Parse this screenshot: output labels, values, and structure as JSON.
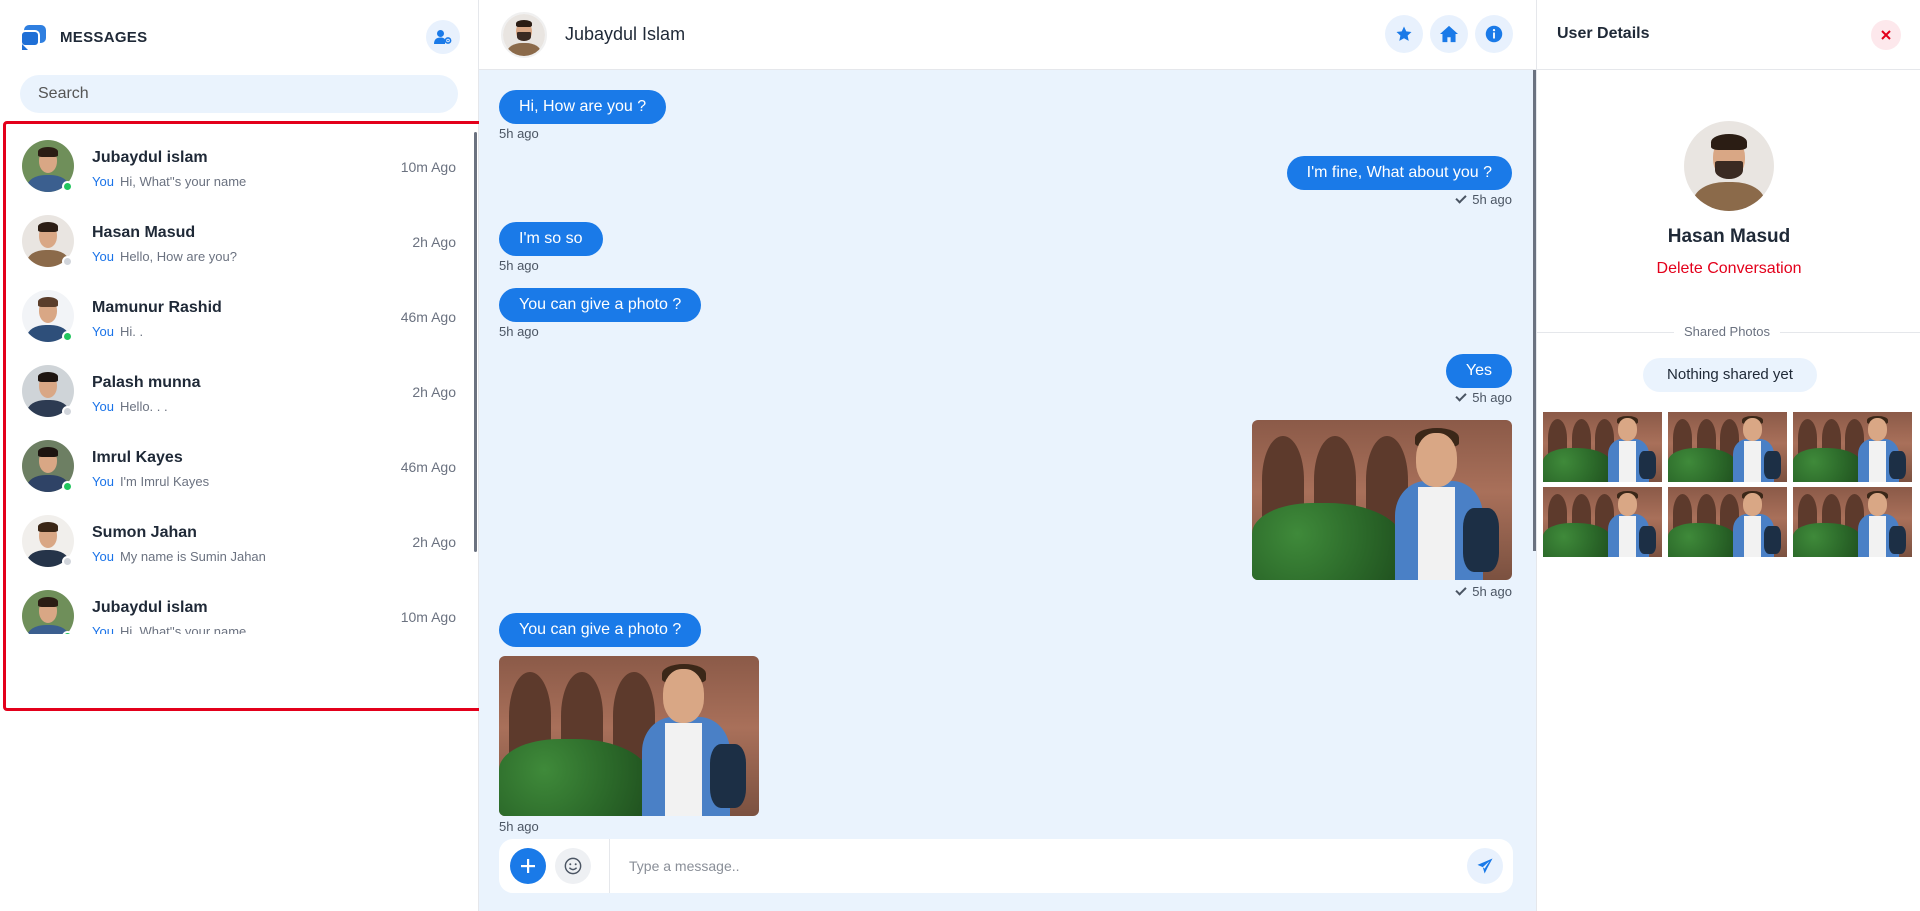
{
  "sidebar": {
    "title": "MESSAGES",
    "search_placeholder": "Search",
    "conversations": [
      {
        "name": "Jubaydul islam",
        "you": "You",
        "preview": "Hi, What''s your name",
        "time": "10m Ago",
        "online": true,
        "bg": "#6f8f5a",
        "body": "#3b5f8f",
        "hair": "#2b1d14"
      },
      {
        "name": "Hasan Masud",
        "you": "You",
        "preview": "Hello, How are you?",
        "time": "2h Ago",
        "online": false,
        "bg": "#e9e5e1",
        "body": "#8b6a4a",
        "hair": "#2b1d14"
      },
      {
        "name": "Mamunur Rashid",
        "you": "You",
        "preview": "Hi. .",
        "time": "46m Ago",
        "online": true,
        "bg": "#f2f4f7",
        "body": "#2e4f7a",
        "hair": "#5a3d2a"
      },
      {
        "name": "Palash munna",
        "you": "You",
        "preview": "Hello. . .",
        "time": "2h Ago",
        "online": false,
        "bg": "#cfd4d8",
        "body": "#2d3b52",
        "hair": "#1d1410"
      },
      {
        "name": "Imrul Kayes",
        "you": "You",
        "preview": "I'm Imrul Kayes",
        "time": "46m Ago",
        "online": true,
        "bg": "#6d7f63",
        "body": "#2f4366",
        "hair": "#1d1410"
      },
      {
        "name": "Sumon Jahan",
        "you": "You",
        "preview": "My name is Sumin Jahan",
        "time": "2h Ago",
        "online": false,
        "bg": "#f1efec",
        "body": "#253449",
        "hair": "#3a2616"
      },
      {
        "name": "Jubaydul islam",
        "you": "You",
        "preview": "Hi, What''s your name",
        "time": "10m Ago",
        "online": true,
        "bg": "#6f8f5a",
        "body": "#3b5f8f",
        "hair": "#2b1d14"
      }
    ]
  },
  "chat": {
    "contact_name": "Jubaydul Islam",
    "messages": [
      {
        "text": "Hi, How are you ?",
        "time": "5h ago",
        "side": "left",
        "type": "text"
      },
      {
        "text": "I'm fine, What about you ?",
        "time": "5h ago",
        "side": "right",
        "type": "text"
      },
      {
        "text": "I'm so so",
        "time": "5h ago",
        "side": "left",
        "type": "text"
      },
      {
        "text": "You can give a photo ?",
        "time": "5h ago",
        "side": "left",
        "type": "text"
      },
      {
        "text": "Yes",
        "time": "5h ago",
        "side": "right",
        "type": "text"
      },
      {
        "text": "",
        "time": "5h ago",
        "side": "right",
        "type": "photo"
      },
      {
        "text": "You can give a photo ?",
        "time": "",
        "side": "left",
        "type": "text"
      },
      {
        "text": "",
        "time": "5h ago",
        "side": "left",
        "type": "photo"
      }
    ],
    "input_placeholder": "Type a message.."
  },
  "details": {
    "title": "User Details",
    "name": "Hasan Masud",
    "delete_label": "Delete Conversation",
    "shared_label": "Shared Photos",
    "nothing_shared": "Nothing shared yet"
  },
  "icons": {
    "logo": "chat-bubbles-icon",
    "add_user": "user-cog-icon",
    "star": "star-icon",
    "home": "home-icon",
    "info": "info-icon",
    "plus": "plus-icon",
    "emoji": "smile-icon",
    "send": "send-icon",
    "close": "close-icon"
  },
  "colors": {
    "accent": "#1a7ae8",
    "online": "#22c55e",
    "offline": "#d1d5db",
    "danger": "#e3001b",
    "chat_bg": "#eaf3fd"
  }
}
